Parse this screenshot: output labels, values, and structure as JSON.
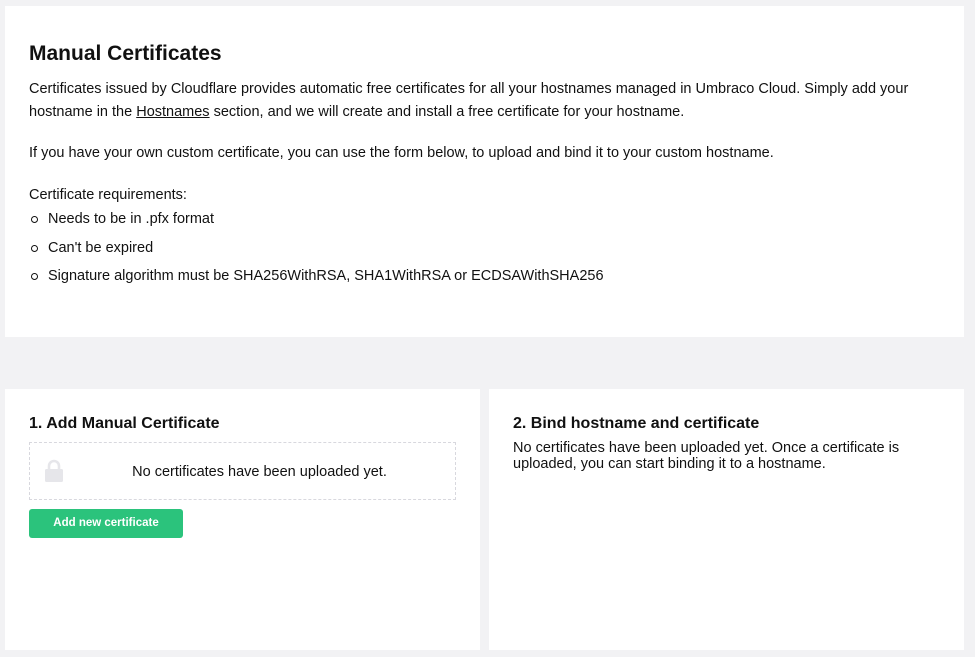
{
  "manual": {
    "title": "Manual Certificates",
    "intro_before_link": "Certificates issued by Cloudflare provides automatic free certificates for all your hostnames managed in Umbraco Cloud. Simply add your hostname in the ",
    "intro_link": "Hostnames",
    "intro_after_link": " section, and we will create and install a free certificate for your hostname.",
    "custom_text": "If you have your own custom certificate, you can use the form below, to upload and bind it to your custom hostname.",
    "requirements_title": "Certificate requirements:",
    "requirements": [
      "Needs to be in .pfx format",
      "Can't be expired",
      "Signature algorithm must be SHA256WithRSA, SHA1WithRSA or ECDSAWithSHA256"
    ]
  },
  "add_certificate": {
    "title": "1. Add Manual Certificate",
    "empty_text": "No certificates have been uploaded yet.",
    "button_label": "Add new certificate",
    "icon": "lock-icon"
  },
  "bind": {
    "title": "2. Bind hostname and certificate",
    "text": "No certificates have been uploaded yet. Once a certificate is uploaded, you can start binding it to a hostname."
  },
  "colors": {
    "background": "#f2f2f4",
    "panel": "#ffffff",
    "button": "#2bc37c",
    "lock_icon": "#e6e6ea"
  }
}
